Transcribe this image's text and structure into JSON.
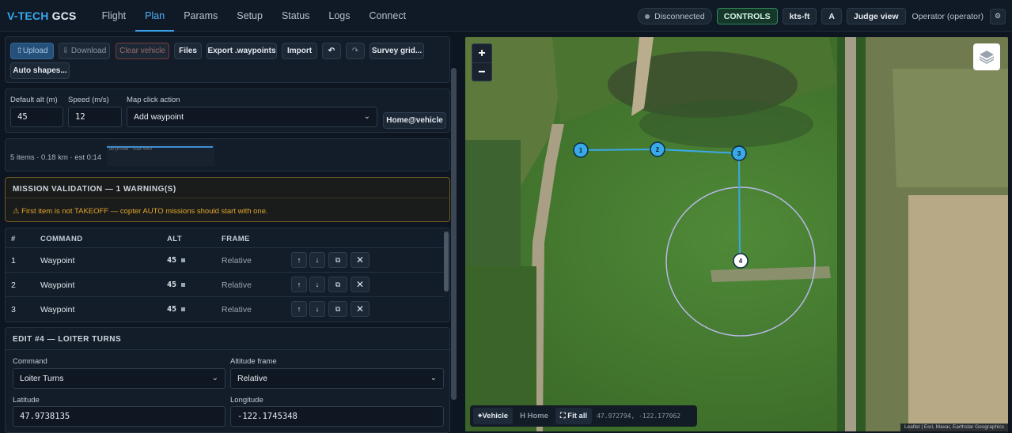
{
  "app": {
    "brand_prefix": "V-TECH",
    "brand_suffix": "GCS",
    "nav_tabs": [
      {
        "label": "Flight"
      },
      {
        "label": "Plan"
      },
      {
        "label": "Params"
      },
      {
        "label": "Setup"
      },
      {
        "label": "Status"
      },
      {
        "label": "Logs"
      },
      {
        "label": "Connect"
      }
    ],
    "active_tab": "Plan",
    "status": "Disconnected",
    "controls_label": "CONTROLS",
    "units_label": "kts-ft",
    "a_label": "A",
    "judge_label": "Judge view",
    "operator_label": "Operator (operator)",
    "settings_icon": "gear-icon"
  },
  "toolbar": {
    "upload": "⇧Upload",
    "download": "⇩ Download",
    "clear_vehicle": "Clear vehicle",
    "files": "Files",
    "export": "Export .waypoints",
    "import": "Import",
    "undo": "↶",
    "redo": "↷",
    "survey": "Survey grid...",
    "auto_shapes": "Auto shapes..."
  },
  "defaults": {
    "alt_label": "Default alt (m)",
    "alt_value": "45",
    "speed_label": "Speed (m/s)",
    "speed_value": "12",
    "click_label": "Map click action",
    "click_value": "Add waypoint",
    "home_btn": "Home@vehicle"
  },
  "stats": {
    "summary": "5 items · 0.18 km · est 0:14",
    "profile_caption": "alt profile · max 45m"
  },
  "validation": {
    "title": "MISSION VALIDATION — 1 WARNING(S)",
    "message": "⚠ First item is not TAKEOFF — copter AUTO missions should start with one."
  },
  "table": {
    "headers": [
      "#",
      "COMMAND",
      "ALT",
      "FRAME"
    ],
    "rows": [
      {
        "num": "1",
        "command": "Waypoint",
        "alt": "45",
        "frame": "Relative"
      },
      {
        "num": "2",
        "command": "Waypoint",
        "alt": "45",
        "frame": "Relative"
      },
      {
        "num": "3",
        "command": "Waypoint",
        "alt": "45",
        "frame": "Relative"
      }
    ],
    "row_buttons": {
      "up": "↑",
      "down": "↓",
      "duplicate": "⧉",
      "delete": "✕"
    }
  },
  "edit": {
    "title": "EDIT #4 — LOITER TURNS",
    "command_label": "Command",
    "command_value": "Loiter Turns",
    "alt_frame_label": "Altitude frame",
    "alt_frame_value": "Relative",
    "lat_label": "Latitude",
    "lat_value": "47.9738135",
    "lon_label": "Longitude",
    "lon_value": "-122.1745348"
  },
  "map": {
    "zoom_in": "+",
    "zoom_out": "−",
    "waypoint_labels": [
      "1",
      "2",
      "3",
      "4"
    ],
    "vehicle_btn": "⌖Vehicle",
    "home_btn": "H Home",
    "fit_btn": "⛶ Fit all",
    "coords": "47.972794, -122.177062",
    "attribution": "Leaflet | Esri, Maxar, Earthstar Geographics",
    "colors": {
      "route": "#3aa9e8",
      "loiter": "#b8b8e8"
    }
  }
}
